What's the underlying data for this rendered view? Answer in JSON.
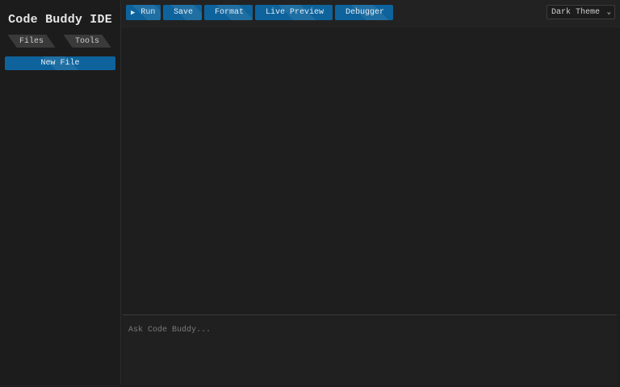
{
  "app": {
    "title": "Code Buddy IDE"
  },
  "sidebar": {
    "tabs": [
      {
        "label": "Files"
      },
      {
        "label": "Tools"
      }
    ],
    "new_file_label": "New File"
  },
  "toolbar": {
    "buttons": [
      {
        "icon": "play-icon",
        "glyph": "▶",
        "label": "Run"
      },
      {
        "icon": "save-icon",
        "glyph": "",
        "label": "Save"
      },
      {
        "icon": "format-icon",
        "glyph": "",
        "label": "Format"
      },
      {
        "icon": "preview-icon",
        "glyph": "",
        "label": "Live Preview"
      },
      {
        "icon": "bug-icon",
        "glyph": "",
        "label": "Debugger"
      }
    ],
    "theme_select": {
      "value": "Dark Theme"
    }
  },
  "chat": {
    "placeholder": "Ask Code Buddy..."
  },
  "colors": {
    "accent": "#0e639c",
    "background": "#1e1e1e",
    "sidebar": "#1c1c1c"
  }
}
